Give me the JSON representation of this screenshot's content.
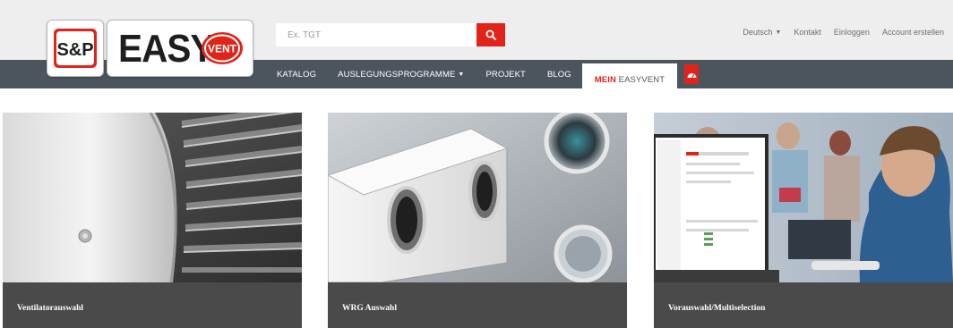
{
  "search": {
    "placeholder": "Ex. TGT"
  },
  "top_links": {
    "language": "Deutsch",
    "contact": "Kontakt",
    "login": "Einloggen",
    "register": "Account erstellen"
  },
  "logo": {
    "brand": "S&P",
    "product_word": "EASY",
    "product_badge": "VENT"
  },
  "nav": {
    "catalog": "KATALOG",
    "programs": "AUSLEGUNGSPROGRAMME",
    "project": "PROJEKT",
    "blog": "BLOG",
    "mine_prefix": "MEIN",
    "mine_suffix": "EASYVENT"
  },
  "cards": [
    {
      "title": "Ventilatorauswahl"
    },
    {
      "title": "WRG Auswahl"
    },
    {
      "title": "Vorauswahl/Multiselection"
    }
  ],
  "colors": {
    "accent": "#e2231a",
    "navbar": "#4c555e",
    "topbar": "#eeeeee",
    "card_footer": "#4a4a4a"
  },
  "icons": [
    "search-icon",
    "chevron-down-icon",
    "dashboard-icon"
  ]
}
